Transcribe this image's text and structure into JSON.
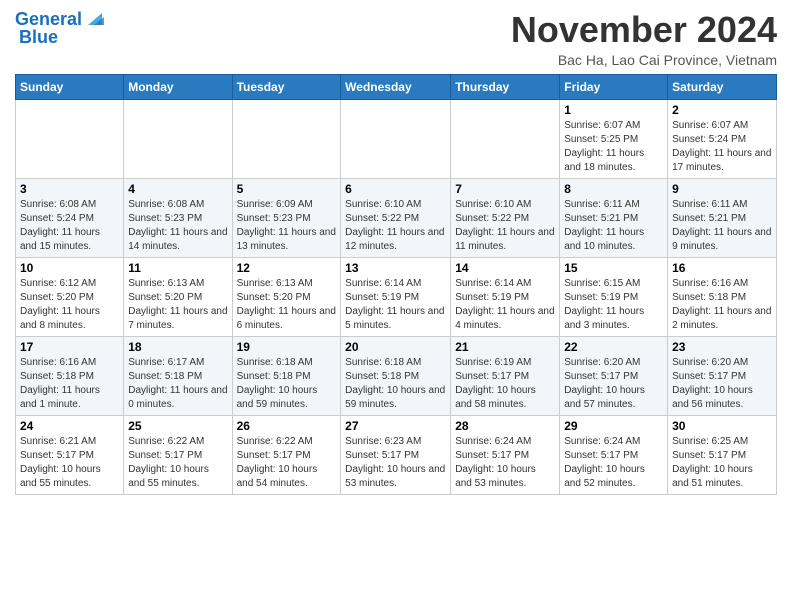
{
  "header": {
    "logo_line1": "General",
    "logo_line2": "Blue",
    "month_title": "November 2024",
    "location": "Bac Ha, Lao Cai Province, Vietnam"
  },
  "weekdays": [
    "Sunday",
    "Monday",
    "Tuesday",
    "Wednesday",
    "Thursday",
    "Friday",
    "Saturday"
  ],
  "weeks": [
    [
      {
        "day": "",
        "info": ""
      },
      {
        "day": "",
        "info": ""
      },
      {
        "day": "",
        "info": ""
      },
      {
        "day": "",
        "info": ""
      },
      {
        "day": "",
        "info": ""
      },
      {
        "day": "1",
        "info": "Sunrise: 6:07 AM\nSunset: 5:25 PM\nDaylight: 11 hours and 18 minutes."
      },
      {
        "day": "2",
        "info": "Sunrise: 6:07 AM\nSunset: 5:24 PM\nDaylight: 11 hours and 17 minutes."
      }
    ],
    [
      {
        "day": "3",
        "info": "Sunrise: 6:08 AM\nSunset: 5:24 PM\nDaylight: 11 hours and 15 minutes."
      },
      {
        "day": "4",
        "info": "Sunrise: 6:08 AM\nSunset: 5:23 PM\nDaylight: 11 hours and 14 minutes."
      },
      {
        "day": "5",
        "info": "Sunrise: 6:09 AM\nSunset: 5:23 PM\nDaylight: 11 hours and 13 minutes."
      },
      {
        "day": "6",
        "info": "Sunrise: 6:10 AM\nSunset: 5:22 PM\nDaylight: 11 hours and 12 minutes."
      },
      {
        "day": "7",
        "info": "Sunrise: 6:10 AM\nSunset: 5:22 PM\nDaylight: 11 hours and 11 minutes."
      },
      {
        "day": "8",
        "info": "Sunrise: 6:11 AM\nSunset: 5:21 PM\nDaylight: 11 hours and 10 minutes."
      },
      {
        "day": "9",
        "info": "Sunrise: 6:11 AM\nSunset: 5:21 PM\nDaylight: 11 hours and 9 minutes."
      }
    ],
    [
      {
        "day": "10",
        "info": "Sunrise: 6:12 AM\nSunset: 5:20 PM\nDaylight: 11 hours and 8 minutes."
      },
      {
        "day": "11",
        "info": "Sunrise: 6:13 AM\nSunset: 5:20 PM\nDaylight: 11 hours and 7 minutes."
      },
      {
        "day": "12",
        "info": "Sunrise: 6:13 AM\nSunset: 5:20 PM\nDaylight: 11 hours and 6 minutes."
      },
      {
        "day": "13",
        "info": "Sunrise: 6:14 AM\nSunset: 5:19 PM\nDaylight: 11 hours and 5 minutes."
      },
      {
        "day": "14",
        "info": "Sunrise: 6:14 AM\nSunset: 5:19 PM\nDaylight: 11 hours and 4 minutes."
      },
      {
        "day": "15",
        "info": "Sunrise: 6:15 AM\nSunset: 5:19 PM\nDaylight: 11 hours and 3 minutes."
      },
      {
        "day": "16",
        "info": "Sunrise: 6:16 AM\nSunset: 5:18 PM\nDaylight: 11 hours and 2 minutes."
      }
    ],
    [
      {
        "day": "17",
        "info": "Sunrise: 6:16 AM\nSunset: 5:18 PM\nDaylight: 11 hours and 1 minute."
      },
      {
        "day": "18",
        "info": "Sunrise: 6:17 AM\nSunset: 5:18 PM\nDaylight: 11 hours and 0 minutes."
      },
      {
        "day": "19",
        "info": "Sunrise: 6:18 AM\nSunset: 5:18 PM\nDaylight: 10 hours and 59 minutes."
      },
      {
        "day": "20",
        "info": "Sunrise: 6:18 AM\nSunset: 5:18 PM\nDaylight: 10 hours and 59 minutes."
      },
      {
        "day": "21",
        "info": "Sunrise: 6:19 AM\nSunset: 5:17 PM\nDaylight: 10 hours and 58 minutes."
      },
      {
        "day": "22",
        "info": "Sunrise: 6:20 AM\nSunset: 5:17 PM\nDaylight: 10 hours and 57 minutes."
      },
      {
        "day": "23",
        "info": "Sunrise: 6:20 AM\nSunset: 5:17 PM\nDaylight: 10 hours and 56 minutes."
      }
    ],
    [
      {
        "day": "24",
        "info": "Sunrise: 6:21 AM\nSunset: 5:17 PM\nDaylight: 10 hours and 55 minutes."
      },
      {
        "day": "25",
        "info": "Sunrise: 6:22 AM\nSunset: 5:17 PM\nDaylight: 10 hours and 55 minutes."
      },
      {
        "day": "26",
        "info": "Sunrise: 6:22 AM\nSunset: 5:17 PM\nDaylight: 10 hours and 54 minutes."
      },
      {
        "day": "27",
        "info": "Sunrise: 6:23 AM\nSunset: 5:17 PM\nDaylight: 10 hours and 53 minutes."
      },
      {
        "day": "28",
        "info": "Sunrise: 6:24 AM\nSunset: 5:17 PM\nDaylight: 10 hours and 53 minutes."
      },
      {
        "day": "29",
        "info": "Sunrise: 6:24 AM\nSunset: 5:17 PM\nDaylight: 10 hours and 52 minutes."
      },
      {
        "day": "30",
        "info": "Sunrise: 6:25 AM\nSunset: 5:17 PM\nDaylight: 10 hours and 51 minutes."
      }
    ]
  ]
}
